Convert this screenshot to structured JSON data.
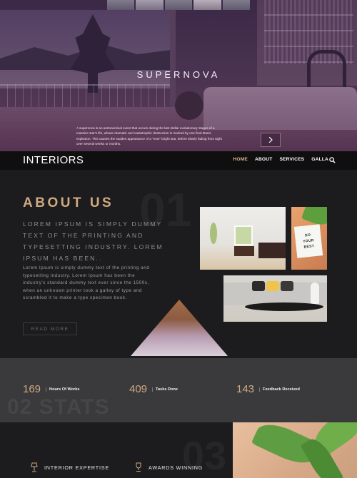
{
  "hero": {
    "title": "SUPERNOVA",
    "caption": "A supernova is an astronomical event that occurs during the last stellar evolutionary stages of a massive star's life, whose dramatic and catastrophic destruction is marked by one final titanic explosion. This causes the sudden appearance of a \"new\" bright star, before slowly fading from sight over several weeks or months.",
    "next_icon": "chevron-right-icon"
  },
  "nav": {
    "brand": "INTERIORS",
    "items": [
      {
        "label": "HOME",
        "active": true
      },
      {
        "label": "ABOUT",
        "active": false
      },
      {
        "label": "SERVICES",
        "active": false
      },
      {
        "label": "GALLA",
        "active": false
      }
    ],
    "search_icon": "search-icon"
  },
  "about": {
    "section_number": "01",
    "heading": "ABOUT US",
    "lead": "LOREM IPSUM IS SIMPLY DUMMY TEXT OF THE PRINTING AND TYPESETTING INDUSTRY. LOREM IPSUM HAS BEEN..",
    "body": "Lorem Ipsum is simply dummy text of the printing and typesetting industry. Lorem Ipsum has been the industry's standard dummy text ever since the 1500s, when an unknown printer took a galley of type and scrambled it to make a type specimen book.",
    "read_more": "READ MORE",
    "sign_lines": [
      "DO",
      "YOUR",
      "BEST"
    ]
  },
  "stats": {
    "section_label": "02 STATS",
    "items": [
      {
        "value": "169",
        "label": "Hours Of Works"
      },
      {
        "value": "409",
        "label": "Tasks Done"
      },
      {
        "value": "143",
        "label": "Feedback Received"
      }
    ]
  },
  "services": {
    "section_number": "03",
    "items": [
      {
        "label": "INTERIOR EXPERTISE",
        "icon": "lamp-icon"
      },
      {
        "label": "AWARDS WINNING",
        "icon": "trophy-icon"
      }
    ]
  },
  "colors": {
    "accent": "#cfa980",
    "nav_active": "#d8b887",
    "dark_bg": "#1c1c1e",
    "stats_bg": "#3a3a3d"
  }
}
